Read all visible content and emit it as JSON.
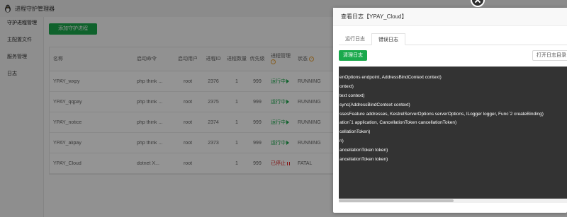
{
  "app": {
    "title": "进程守护管理器"
  },
  "sidebar": {
    "items": [
      {
        "label": "守护进程管理"
      },
      {
        "label": "主配置文件"
      },
      {
        "label": "服务管理"
      },
      {
        "label": "日志"
      }
    ]
  },
  "toolbar": {
    "add_label": "添加守护进程"
  },
  "table": {
    "headers": {
      "name": "名称",
      "command": "启动命令",
      "user": "启动用户",
      "pid": "进程ID",
      "count": "进程数量",
      "priority": "优先级",
      "manage": "进程管理",
      "status": "状态"
    },
    "rows": [
      {
        "name": "YPAY_wxpy",
        "command": "php think ...",
        "user": "root",
        "pid": "2376",
        "count": "1",
        "priority": "999",
        "manage": "运行中",
        "status": "RUNNING"
      },
      {
        "name": "YPAY_qqpay",
        "command": "php think ...",
        "user": "root",
        "pid": "2375",
        "count": "1",
        "priority": "999",
        "manage": "运行中",
        "status": "RUNNING"
      },
      {
        "name": "YPAY_notice",
        "command": "php think ...",
        "user": "root",
        "pid": "2374",
        "count": "1",
        "priority": "999",
        "manage": "运行中",
        "status": "RUNNING"
      },
      {
        "name": "YPAY_alipay",
        "command": "php think ...",
        "user": "root",
        "pid": "2373",
        "count": "1",
        "priority": "999",
        "manage": "运行中",
        "status": "RUNNING"
      },
      {
        "name": "YPAY_Cloud",
        "command": "dotnet X...",
        "user": "root",
        "pid": "",
        "count": "1",
        "priority": "999",
        "manage": "已停止",
        "status": "FATAL"
      }
    ]
  },
  "dialog": {
    "title": "查看日志【YPAY_Cloud】",
    "tabs": [
      {
        "label": "运行日志",
        "active": false
      },
      {
        "label": "错误日志",
        "active": true
      }
    ],
    "clear_label": "清理日志",
    "open_dir_label": "打开日志目录",
    "log_lines": [
      "enOptions endpoint, AddressBindContext context)",
      "ontext)",
      "text context)",
      "sync(AddressBindContext context)",
      "ssesFeature addresses, KestrelServerOptions serverOptions, ILogger logger, Func`2 createBinding)",
      "ation`1 application, CancellationToken cancellationToken)",
      "cellationToken)",
      "n)",
      "ancellationToken token)",
      "ancellationToken token)"
    ]
  },
  "colors": {
    "accent_green": "#1aa94c",
    "stopped_red": "#e02020",
    "log_background": "#333333"
  }
}
